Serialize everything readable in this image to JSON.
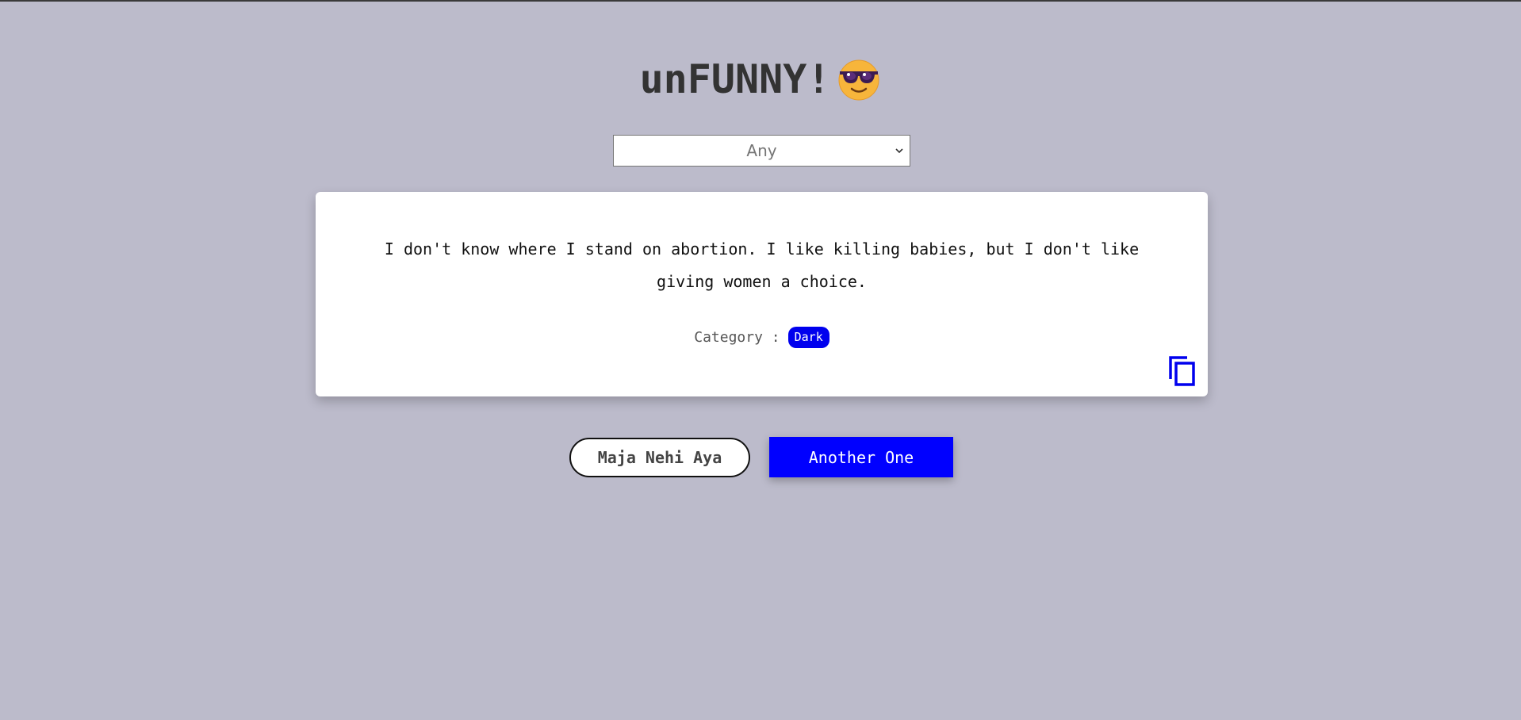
{
  "header": {
    "title": "unFUNNY!",
    "emoji_icon": "smiling-face-with-sunglasses-icon"
  },
  "category_select": {
    "selected": "Any"
  },
  "joke_card": {
    "text": "I don't know where I stand on abortion. I like killing babies, but I don't like giving women a choice.",
    "category_label": "Category :",
    "category_value": "Dark",
    "copy_icon": "copy-icon"
  },
  "actions": {
    "dislike_label": "Maja Nehi Aya",
    "next_label": "Another One"
  },
  "colors": {
    "background": "#bcbbcb",
    "accent": "#0000ff",
    "title": "#333333"
  }
}
